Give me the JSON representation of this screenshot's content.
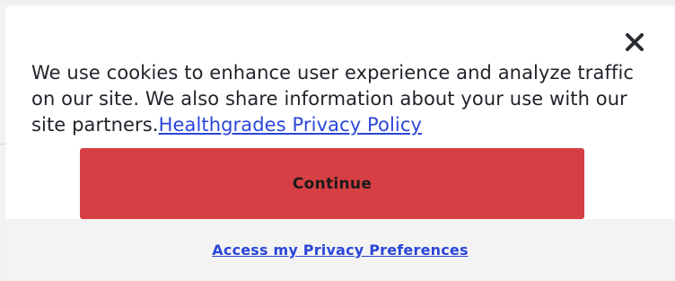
{
  "cookie_banner": {
    "close_icon": "close-icon",
    "message_text": "We use cookies to enhance user experience and analyze traffic on our site. We also share information about your use with our site partners.",
    "privacy_link_label": "Healthgrades Privacy Policy",
    "continue_label": "Continue",
    "preferences_link_label": "Access my Privacy Preferences",
    "colors": {
      "continue_button": "#d63f43",
      "link": "#2b46d8",
      "text": "#1f2329",
      "preferences_band": "#f3f3f3"
    }
  }
}
